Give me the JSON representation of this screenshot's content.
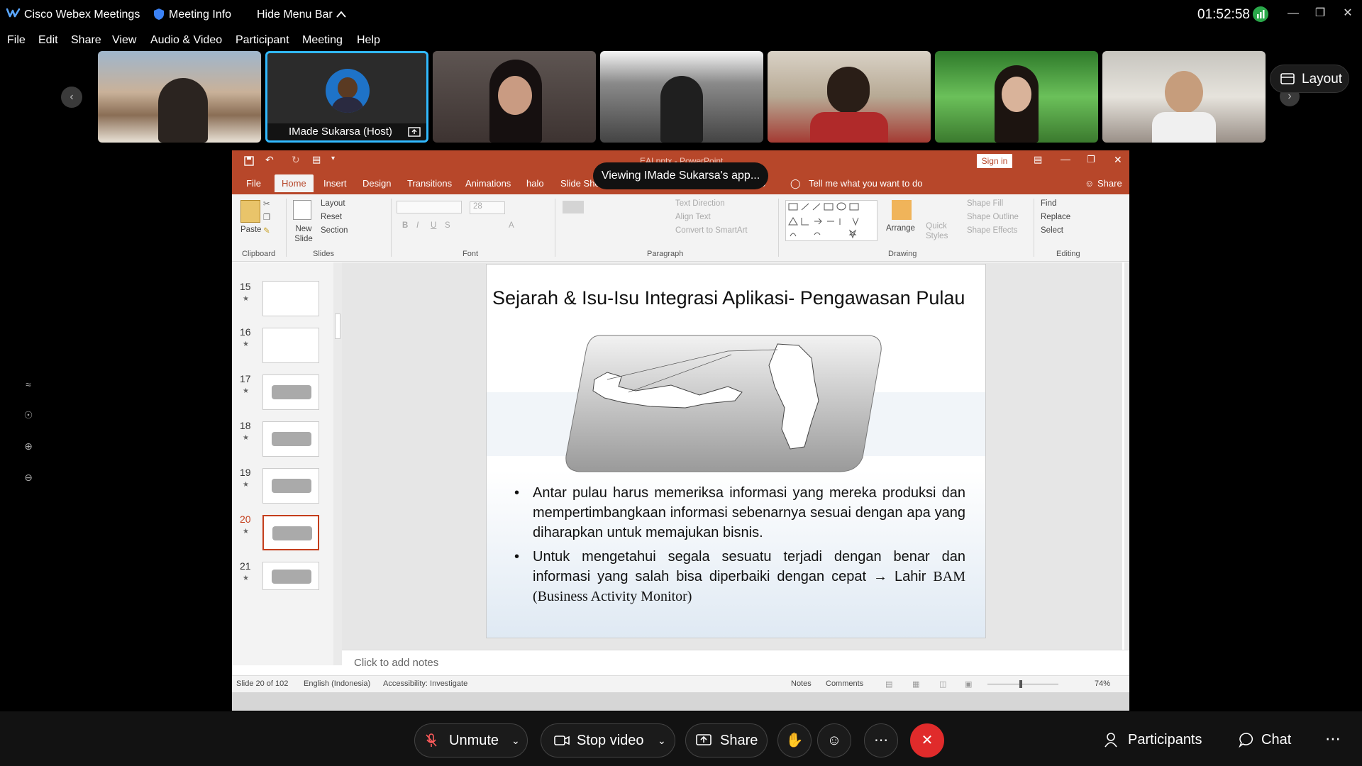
{
  "titlebar": {
    "app_title": "Cisco Webex Meetings",
    "meeting_info": "Meeting Info",
    "hide_menu": "Hide Menu Bar",
    "clock": "01:52:58"
  },
  "menu": [
    "File",
    "Edit",
    "Share",
    "View",
    "Audio & Video",
    "Participant",
    "Meeting",
    "Help"
  ],
  "participants_strip": {
    "host_name": "IMade Sukarsa  (Host)",
    "layout_label": "Layout"
  },
  "toast": "Viewing IMade Sukarsa's app...",
  "ppt": {
    "title_partial": "EAI.pptx - PowerPoint",
    "sign_in": "Sign in",
    "tabs": [
      "File",
      "Home",
      "Insert",
      "Design",
      "Transitions",
      "Animations",
      "halo",
      "Slide Show",
      "o"
    ],
    "tell_me": "Tell me what you want to do",
    "share": "Share",
    "ribbon": {
      "paste": "Paste",
      "new_slide": "New Slide",
      "layout": "Layout",
      "reset": "Reset",
      "section": "Section",
      "font_size": "28",
      "text_direction": "Text Direction",
      "align_text": "Align Text",
      "convert_smartart": "Convert to SmartArt",
      "arrange": "Arrange",
      "quick_styles": "Quick Styles",
      "shape_fill": "Shape Fill",
      "shape_outline": "Shape Outline",
      "shape_effects": "Shape Effects",
      "find": "Find",
      "replace": "Replace",
      "select": "Select",
      "groups": [
        "Clipboard",
        "Slides",
        "Font",
        "Paragraph",
        "Drawing",
        "Editing"
      ]
    },
    "thumbnails": [
      "15",
      "16",
      "17",
      "18",
      "19",
      "20",
      "21"
    ],
    "active_slide": "20",
    "slide": {
      "title": "Sejarah & Isu-Isu Integrasi Aplikasi- Pengawasan Pulau",
      "bullet1": "Antar pulau harus memeriksa informasi yang mereka produksi dan mempertimbangkaan informasi sebenarnya sesuai dengan apa yang diharapkan untuk memajukan bisnis.",
      "bullet2": "Untuk mengetahui segala sesuatu terjadi dengan benar dan informasi yang salah bisa diperbaiki dengan cepat → Lahir",
      "bullet2_tail": "BAM (Business Activity Monitor)"
    },
    "notes_placeholder": "Click to add notes",
    "status": {
      "slide_count": "Slide 20 of 102",
      "language": "English (Indonesia)",
      "accessibility": "Accessibility: Investigate",
      "notes": "Notes",
      "comments": "Comments",
      "zoom": "74%"
    }
  },
  "controls": {
    "unmute": "Unmute",
    "stop_video": "Stop video",
    "share": "Share",
    "participants": "Participants",
    "chat": "Chat"
  }
}
